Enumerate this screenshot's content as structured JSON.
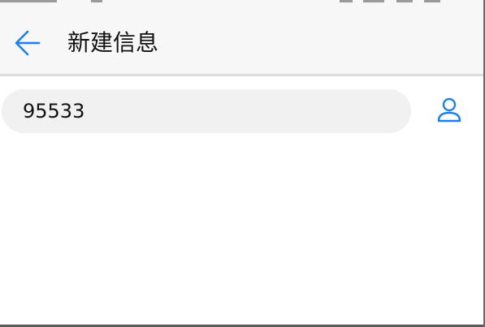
{
  "header": {
    "back_icon": "arrow-left-icon",
    "title": "新建信息"
  },
  "recipient": {
    "value": "95533",
    "contact_icon": "person-icon"
  },
  "colors": {
    "accent": "#1a7ff0",
    "app_bar_bg": "#f7f7f7",
    "field_bg": "#f1f1f1",
    "divider": "#dcdcdc"
  }
}
